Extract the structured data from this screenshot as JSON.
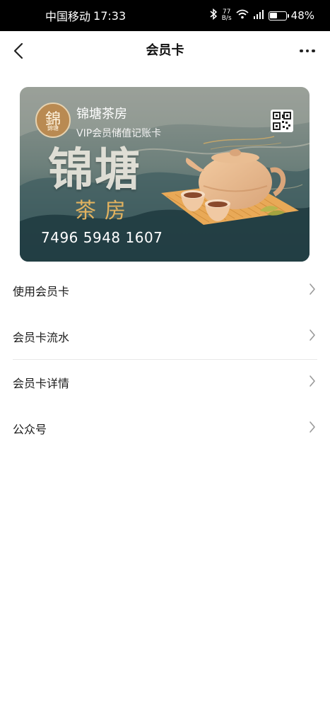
{
  "status_bar": {
    "carrier": "中国移动",
    "time": "17:33",
    "net_speed_value": "77",
    "net_speed_unit": "B/s",
    "battery": "48%",
    "battery_level": 0.48,
    "icons": [
      "bluetooth-icon",
      "wifi-icon",
      "cellular-signal-icon",
      "battery-icon"
    ]
  },
  "nav": {
    "title": "会员卡",
    "back_icon": "chevron-left-icon",
    "more_icon": "more-dots-icon"
  },
  "card": {
    "logo_char": "錦",
    "logo_sub": "錦塘",
    "shop_name": "锦塘茶房",
    "card_type": "VIP会员储值记账卡",
    "big_name": "锦塘",
    "big_sub": "茶房",
    "card_number": "7496 5948 1607",
    "qr_icon": "qr-code-icon",
    "colors": {
      "ink_dark": "#1f3a40",
      "ink_mid": "#4f6b6a",
      "gold": "#e2b25f",
      "teapot": "#e6b58a"
    }
  },
  "menu": [
    {
      "label": "使用会员卡"
    },
    {
      "label": "会员卡流水"
    },
    {
      "label": "会员卡详情"
    },
    {
      "label": "公众号"
    }
  ]
}
